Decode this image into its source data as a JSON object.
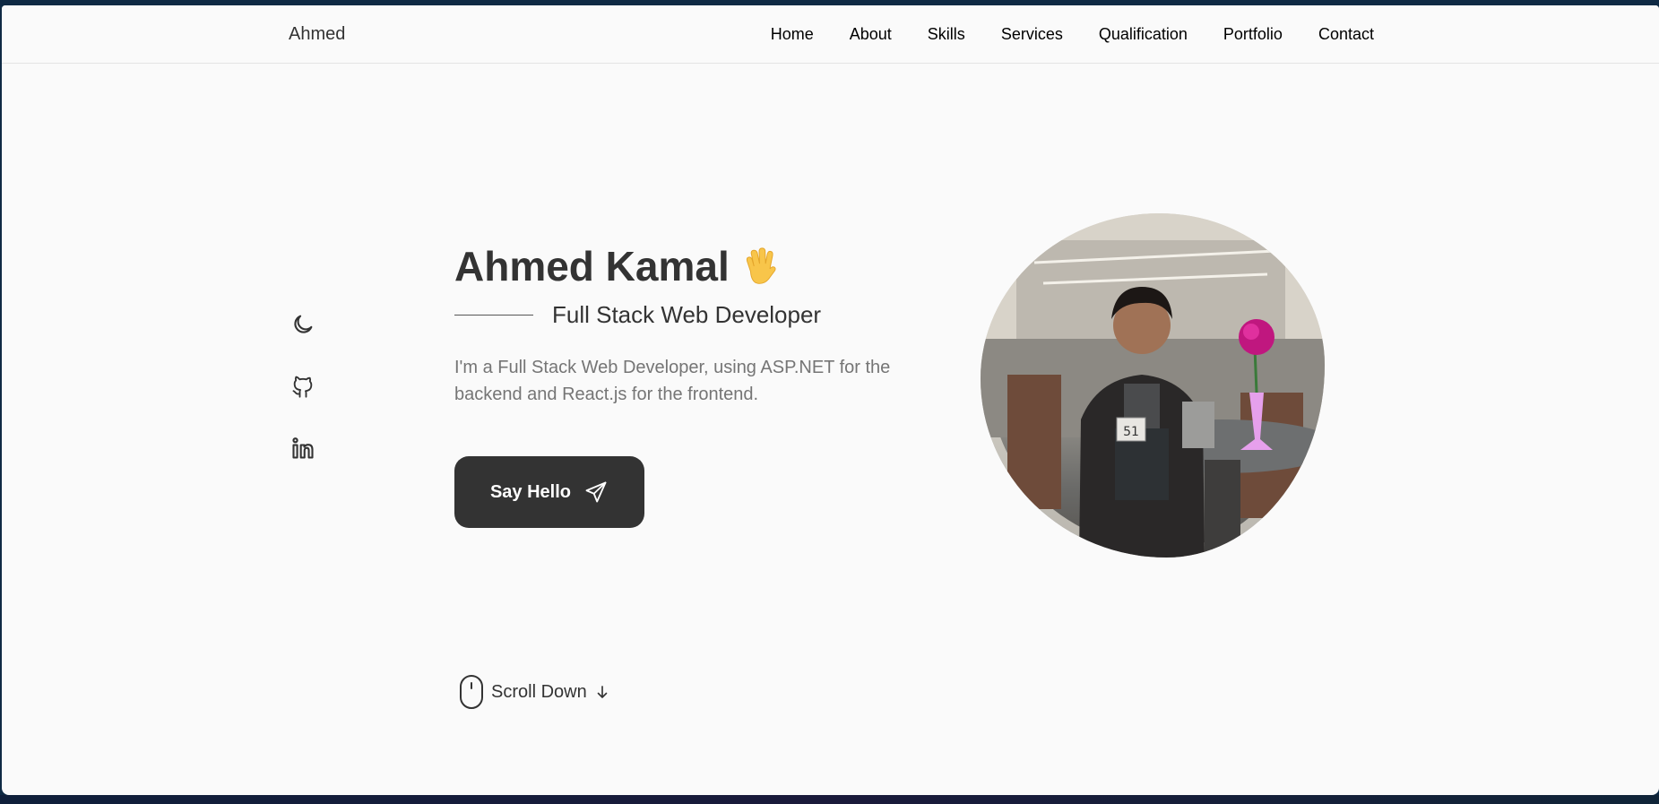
{
  "header": {
    "logo": "Ahmed",
    "nav": [
      "Home",
      "About",
      "Skills",
      "Services",
      "Qualification",
      "Portfolio",
      "Contact"
    ]
  },
  "hero": {
    "name": "Ahmed Kamal",
    "title": "Full Stack Web Developer",
    "description": "I'm a Full Stack Web Developer, using ASP.NET for the backend and React.js for the frontend.",
    "cta_label": "Say Hello",
    "scroll_label": "Scroll Down",
    "table_number": "51"
  },
  "socials": [
    "moon-icon",
    "github-icon",
    "linkedin-icon"
  ],
  "colors": {
    "primary": "#333333",
    "background": "#fafafa",
    "text_muted": "#757575",
    "frame": "#0f2a44"
  }
}
